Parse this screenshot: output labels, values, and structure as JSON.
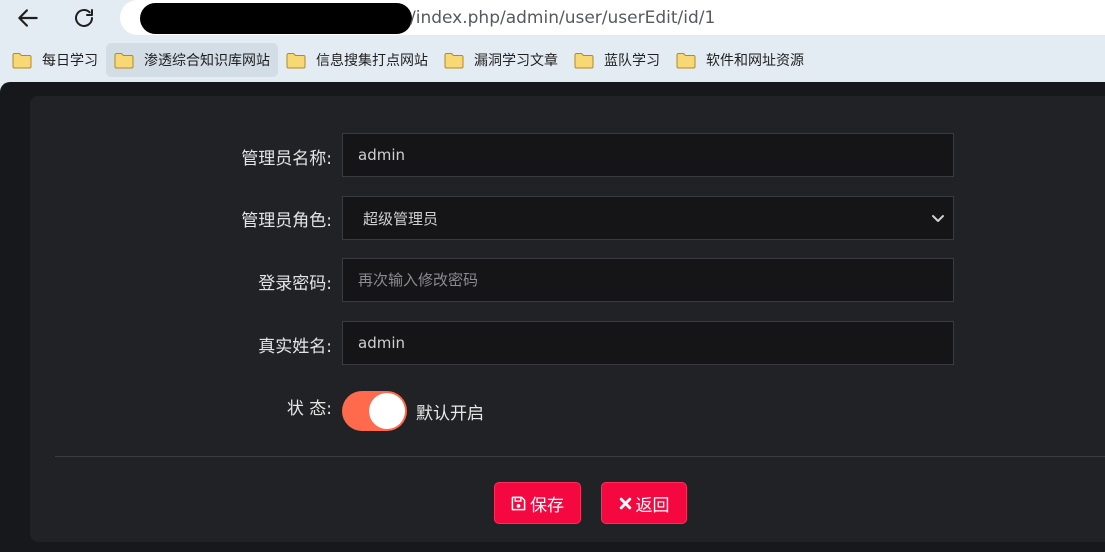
{
  "browser": {
    "url_visible": "/index.php/admin/user/userEdit/id/1",
    "bookmarks": [
      {
        "label": "每日学习"
      },
      {
        "label": "渗透综合知识库网站"
      },
      {
        "label": "信息搜集打点网站"
      },
      {
        "label": "漏洞学习文章"
      },
      {
        "label": "蓝队学习"
      },
      {
        "label": "软件和网址资源"
      }
    ]
  },
  "form": {
    "admin_name": {
      "label": "管理员名称:",
      "value": "admin"
    },
    "admin_role": {
      "label": "管理员角色:",
      "value": "超级管理员"
    },
    "password": {
      "label": "登录密码:",
      "placeholder": "再次输入修改密码"
    },
    "real_name": {
      "label": "真实姓名:",
      "value": "admin"
    },
    "status": {
      "label": "状 态:",
      "toggle_text": "默认开启",
      "on": true
    }
  },
  "actions": {
    "save_label": "保存",
    "back_label": "返回"
  },
  "colors": {
    "toggle_on": "#ff6a4c",
    "button_red": "#f5073f",
    "card_bg": "#212226"
  },
  "icons": [
    "back-arrow-icon",
    "reload-icon",
    "folder-icon",
    "chevron-down-icon",
    "floppy-disk-icon",
    "x-icon"
  ]
}
